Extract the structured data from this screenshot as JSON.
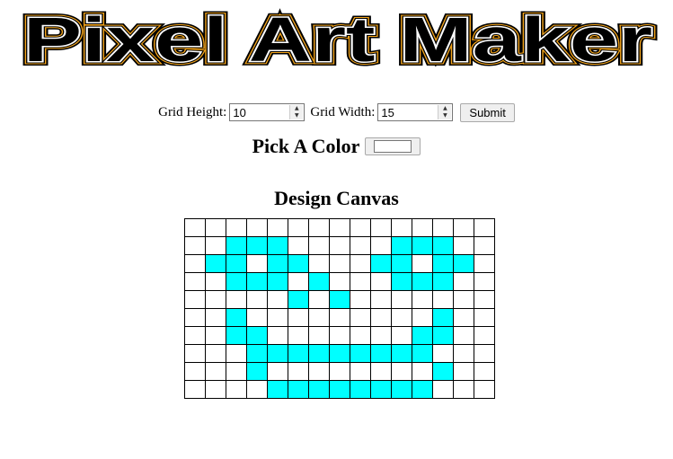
{
  "app": {
    "title": "Pixel Art Maker"
  },
  "form": {
    "height_label": "Grid Height:",
    "height_value": "10",
    "width_label": "Grid Width:",
    "width_value": "15",
    "submit_label": "Submit"
  },
  "color_picker": {
    "label": "Pick A Color",
    "value": "#ffffff"
  },
  "canvas": {
    "title": "Design Canvas",
    "rows": 10,
    "cols": 15,
    "fill_color": "#00ffff",
    "empty_color": "#ffffff",
    "pixels": [
      "000000000000000",
      "002220000022200",
      "022022000220220",
      "002220200022200",
      "000002020000000",
      "002000000000200",
      "002200000002200",
      "000222222222000",
      "000200000000200",
      "000022222222000"
    ]
  }
}
